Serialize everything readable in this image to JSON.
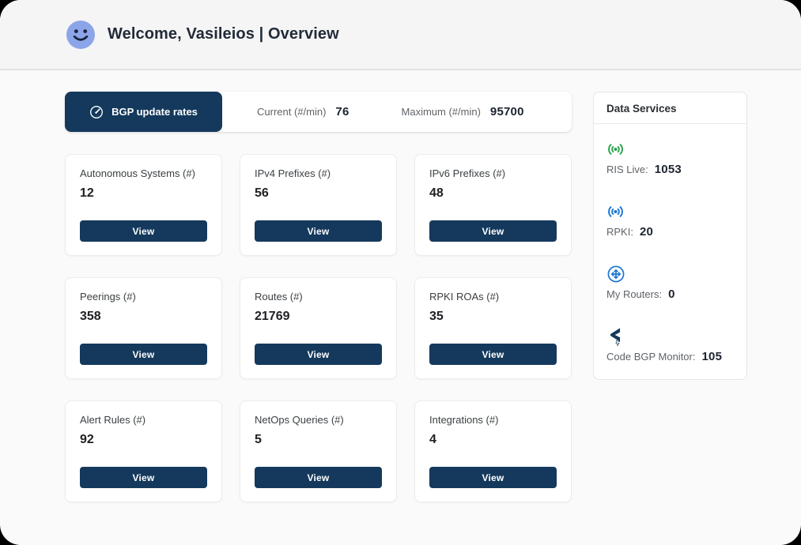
{
  "header": {
    "title": "Welcome, Vasileios | Overview"
  },
  "rates": {
    "tab_label": "BGP update rates",
    "current_label": "Current (#/min)",
    "current_value": "76",
    "maximum_label": "Maximum (#/min)",
    "maximum_value": "95700"
  },
  "cards": [
    {
      "title": "Autonomous Systems (#)",
      "value": "12",
      "button": "View"
    },
    {
      "title": "IPv4 Prefixes (#)",
      "value": "56",
      "button": "View"
    },
    {
      "title": "IPv6 Prefixes (#)",
      "value": "48",
      "button": "View"
    },
    {
      "title": "Peerings (#)",
      "value": "358",
      "button": "View"
    },
    {
      "title": "Routes (#)",
      "value": "21769",
      "button": "View"
    },
    {
      "title": "RPKI ROAs (#)",
      "value": "35",
      "button": "View"
    },
    {
      "title": "Alert Rules (#)",
      "value": "92",
      "button": "View"
    },
    {
      "title": "NetOps Queries (#)",
      "value": "5",
      "button": "View"
    },
    {
      "title": "Integrations (#)",
      "value": "4",
      "button": "View"
    }
  ],
  "data_services": {
    "title": "Data Services",
    "items": [
      {
        "label": "RIS Live:",
        "value": "1053",
        "icon": "broadcast-icon"
      },
      {
        "label": "RPKI:",
        "value": "20",
        "icon": "broadcast-icon"
      },
      {
        "label": "My Routers:",
        "value": "0",
        "icon": "router-icon"
      },
      {
        "label": "Code BGP Monitor:",
        "value": "105",
        "icon": "codebgp-logo-icon"
      }
    ]
  },
  "colors": {
    "navy": "#14395c",
    "green": "#2aa24c",
    "blue": "#1b76d1",
    "smiley_blue": "#8ca5e9",
    "page_bg": "#fafafa"
  }
}
